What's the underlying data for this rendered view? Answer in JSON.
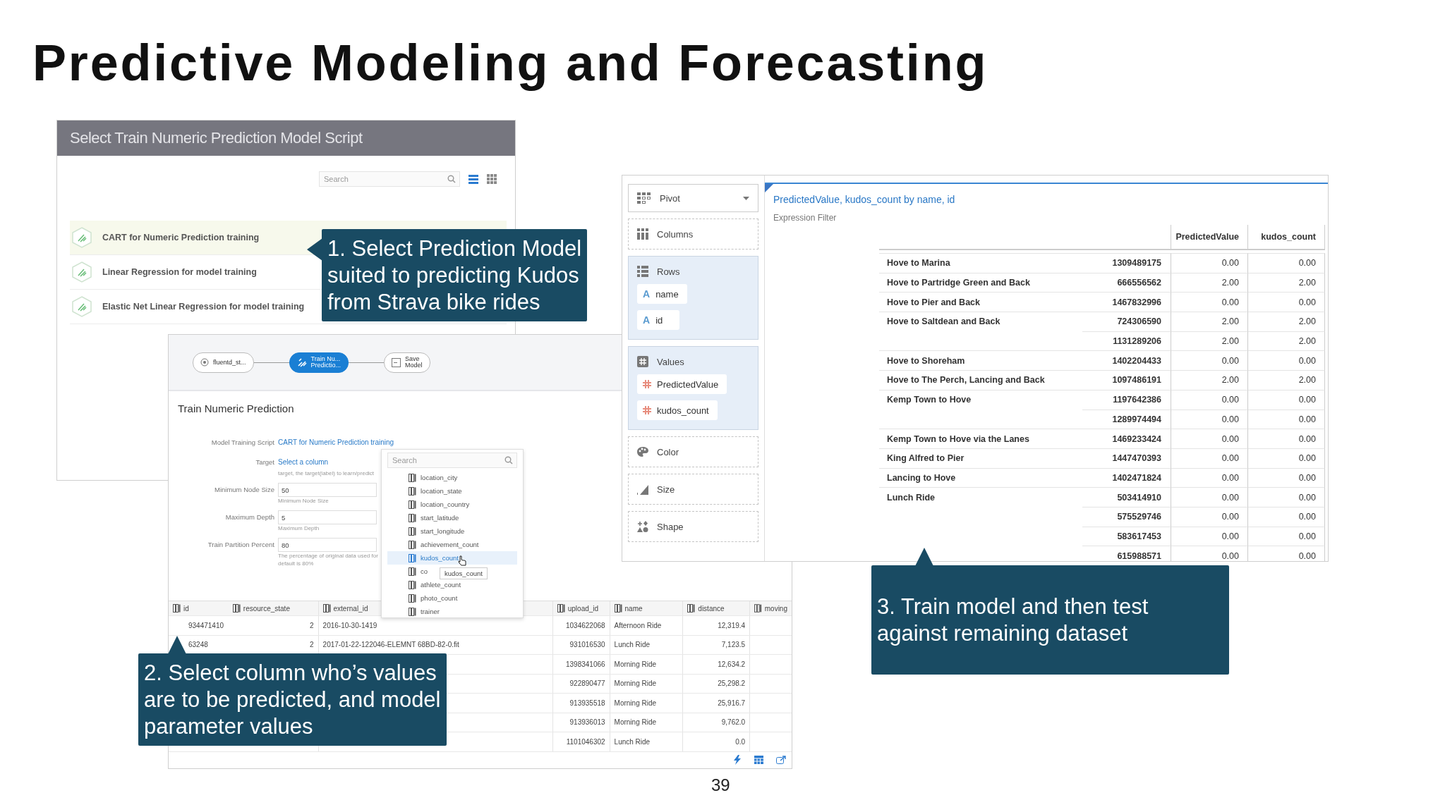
{
  "slide": {
    "title": "Predictive Modeling and Forecasting",
    "page_number": "39"
  },
  "script_dialog": {
    "title": "Select Train Numeric Prediction Model Script",
    "search": {
      "placeholder": "Search"
    },
    "view_modes": [
      {
        "kind": "list",
        "selected": true
      },
      {
        "kind": "grid",
        "selected": false
      }
    ],
    "scripts": [
      {
        "label": "CART for Numeric Prediction training",
        "selected": true
      },
      {
        "label": "Linear Regression for model training",
        "selected": false
      },
      {
        "label": "Elastic Net Linear Regression for model training",
        "selected": false
      }
    ]
  },
  "workflow": {
    "nodes": [
      {
        "kind": "source",
        "label": "fluentd_st...",
        "selected": false
      },
      {
        "kind": "train",
        "label": "Train Nu...\nPredictio...",
        "selected": true
      },
      {
        "kind": "save",
        "label": "Save\nModel",
        "selected": false
      }
    ],
    "form_title": "Train Numeric Prediction",
    "fields": [
      {
        "kind": "link",
        "label": "Model Training Script",
        "value": "CART for Numeric Prediction training"
      },
      {
        "kind": "link",
        "label": "Target",
        "value": "Select a column",
        "help": [
          "target, the target(label) to learn/predict"
        ]
      },
      {
        "kind": "input",
        "label": "Minimum Node Size",
        "value": "50",
        "help": [
          "Minimum Node Size"
        ]
      },
      {
        "kind": "input",
        "label": "Maximum Depth",
        "value": "5",
        "help": [
          "Maximum Depth"
        ]
      },
      {
        "kind": "input",
        "label": "Train Partition Percent",
        "value": "80",
        "help": [
          "The percentage of original data used for",
          "default is 80%"
        ]
      }
    ],
    "column_picker": {
      "search": {
        "placeholder": "Search"
      },
      "items": [
        {
          "label": "location_city",
          "selected": false
        },
        {
          "label": "location_state",
          "selected": false
        },
        {
          "label": "location_country",
          "selected": false
        },
        {
          "label": "start_latitude",
          "selected": false
        },
        {
          "label": "start_longitude",
          "selected": false
        },
        {
          "label": "achievement_count",
          "selected": false
        },
        {
          "label": "kudos_count",
          "selected": true
        },
        {
          "label": "co",
          "selected": false
        },
        {
          "label": "athlete_count",
          "selected": false
        },
        {
          "label": "photo_count",
          "selected": false
        },
        {
          "label": "trainer",
          "selected": false
        }
      ],
      "tooltip": "kudos_count"
    },
    "table": {
      "columns": [
        "id",
        "resource_state",
        "external_id",
        "upload_id",
        "name",
        "distance",
        "moving"
      ],
      "rows": [
        {
          "id": "934471410",
          "resource_state": "2",
          "external_id": "2016-10-30-1419",
          "upload_id": "1034622068",
          "name": "Afternoon Ride",
          "distance": "12,319.4"
        },
        {
          "id": "63248",
          "resource_state": "2",
          "external_id": "2017-01-22-122046-ELEMNT 68BD-82-0.fit",
          "upload_id": "931016530",
          "name": "Lunch Ride",
          "distance": "7,123.5"
        },
        {
          "upload_id": "1398341066",
          "name": "Morning Ride",
          "distance": "12,634.2"
        },
        {
          "upload_id": "922890477",
          "name": "Morning Ride",
          "distance": "25,298.2"
        },
        {
          "upload_id": "913935518",
          "name": "Morning Ride",
          "distance": "25,916.7"
        },
        {
          "upload_id": "913936013",
          "name": "Morning Ride",
          "distance": "9,762.0"
        },
        {
          "upload_id": "1101046302",
          "name": "Lunch Ride",
          "distance": "0.0"
        }
      ]
    }
  },
  "pivot": {
    "chart_type": "Pivot",
    "shelves": [
      {
        "kind": "columns",
        "label": "Columns"
      },
      {
        "kind": "rows",
        "label": "Rows",
        "items": [
          {
            "label": "name",
            "kind": "text",
            "glyph": "A"
          },
          {
            "label": "id",
            "kind": "text",
            "glyph": "A"
          }
        ]
      },
      {
        "kind": "values",
        "label": "Values",
        "items": [
          {
            "label": "PredictedValue",
            "kind": "number"
          },
          {
            "label": "kudos_count",
            "kind": "number"
          }
        ]
      },
      {
        "kind": "color",
        "label": "Color"
      },
      {
        "kind": "size",
        "label": "Size"
      },
      {
        "kind": "shape",
        "label": "Shape"
      }
    ]
  },
  "result": {
    "title": "PredictedValue, kudos_count by name, id",
    "filter_label": "Expression Filter",
    "columns": [
      "PredictedValue",
      "kudos_count"
    ],
    "rows": [
      {
        "name": "Hove to Marina",
        "id": "1309489175",
        "values": [
          "0.00",
          "0.00"
        ]
      },
      {
        "name": "Hove to Partridge Green and Back",
        "id": "666556562",
        "values": [
          "2.00",
          "2.00"
        ]
      },
      {
        "name": "Hove to Pier and Back",
        "id": "1467832996",
        "values": [
          "0.00",
          "0.00"
        ]
      },
      {
        "name": "Hove to Saltdean and Back",
        "id": "724306590",
        "values": [
          "2.00",
          "2.00"
        ]
      },
      {
        "id": "1131289206",
        "values": [
          "2.00",
          "2.00"
        ]
      },
      {
        "name": "Hove to Shoreham",
        "id": "1402204433",
        "values": [
          "0.00",
          "0.00"
        ]
      },
      {
        "name": "Hove to The Perch, Lancing and Back",
        "id": "1097486191",
        "values": [
          "2.00",
          "2.00"
        ]
      },
      {
        "name": "Kemp Town to Hove",
        "id": "1197642386",
        "values": [
          "0.00",
          "0.00"
        ]
      },
      {
        "id": "1289974494",
        "values": [
          "0.00",
          "0.00"
        ]
      },
      {
        "name": "Kemp Town to Hove via the Lanes",
        "id": "1469233424",
        "values": [
          "0.00",
          "0.00"
        ]
      },
      {
        "name": "King Alfred to Pier",
        "id": "1447470393",
        "values": [
          "0.00",
          "0.00"
        ]
      },
      {
        "name": "Lancing to Hove",
        "id": "1402471824",
        "values": [
          "0.00",
          "0.00"
        ]
      },
      {
        "name": "Lunch Ride",
        "id": "503414910",
        "values": [
          "0.00",
          "0.00"
        ]
      },
      {
        "id": "575529746",
        "values": [
          "0.00",
          "0.00"
        ]
      },
      {
        "id": "583617453",
        "values": [
          "0.00",
          "0.00"
        ]
      },
      {
        "id": "615988571",
        "values": [
          "0.00",
          "0.00"
        ]
      }
    ]
  },
  "callouts": [
    {
      "text": "1. Select Prediction Model\nsuited to predicting Kudos\nfrom Strava bike rides",
      "kind": "left"
    },
    {
      "text": "2. Select column who’s values\nare to be predicted, and model\nparameter values",
      "kind": "up"
    },
    {
      "text": "3. Train model and then test\nagainst remaining dataset",
      "kind": "up"
    }
  ]
}
